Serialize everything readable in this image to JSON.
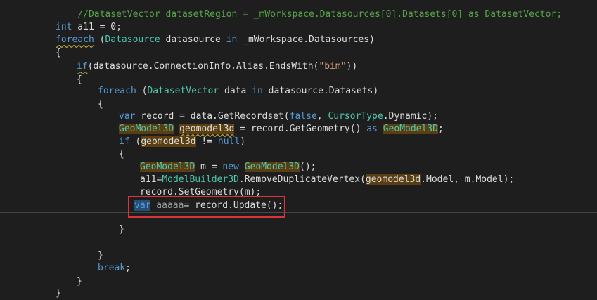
{
  "editor": {
    "language": "C#",
    "lines": {
      "l0": "//DatasetVector datasetRegion = _mWorkspace.Datasources[0].Datasets[0] as DatasetVector;",
      "l2_kw": "int",
      "l2_rest": " a11 = 0;",
      "l3_kw": "foreach",
      "l3_a": " (",
      "l3_ty": "Datasource",
      "l3_b": " datasource ",
      "l3_in": "in",
      "l3_c": " _mWorkspace.Datasources)",
      "l4": "{",
      "l5_kw": "if",
      "l5_a": "(datasource.ConnectionInfo.Alias.EndsWith(",
      "l5_str": "\"bim\"",
      "l5_b": "))",
      "l6": "{",
      "l7_kw": "foreach",
      "l7_a": " (",
      "l7_ty": "DatasetVector",
      "l7_b": " data ",
      "l7_in": "in",
      "l7_c": " datasource.Datasets)",
      "l8": "{",
      "l9_kw": "var",
      "l9_a": " record = data.GetRecordset(",
      "l9_false": "false",
      "l9_b": ", ",
      "l9_ty": "CursorType",
      "l9_c": ".Dynamic);",
      "l10_ty": "GeoModel3D",
      "l10_sp": " ",
      "l10_id": "geomodel3d",
      "l10_a": " = record.GetGeometry() ",
      "l10_as": "as",
      "l10_sp2": " ",
      "l10_ty2": "GeoModel3D",
      "l10_end": ";",
      "l11_kw": "if",
      "l11_a": " (",
      "l11_id": "geomodel3d",
      "l11_b": " != ",
      "l11_null": "null",
      "l11_c": ")",
      "l12": "{",
      "l13_ty": "GeoModel3D",
      "l13_a": " m = ",
      "l13_new": "new",
      "l13_sp": " ",
      "l13_ty2": "GeoModel3D",
      "l13_b": "();",
      "l14_a": "a11=",
      "l14_ty": "ModelBuilder3D",
      "l14_b": ".RemoveDuplicateVertex(",
      "l14_id": "geomodel3d",
      "l14_c": ".Model, m.Model);",
      "l15": "record.SetGeometry(m);",
      "l16_kw": "var",
      "l16_dim": " aaaaa",
      "l16_rest": "= record.Update();",
      "l18": "}",
      "l20": "}",
      "l21_kw": "break",
      "l21_rest": ";",
      "l22": "}",
      "l23": "}"
    }
  }
}
